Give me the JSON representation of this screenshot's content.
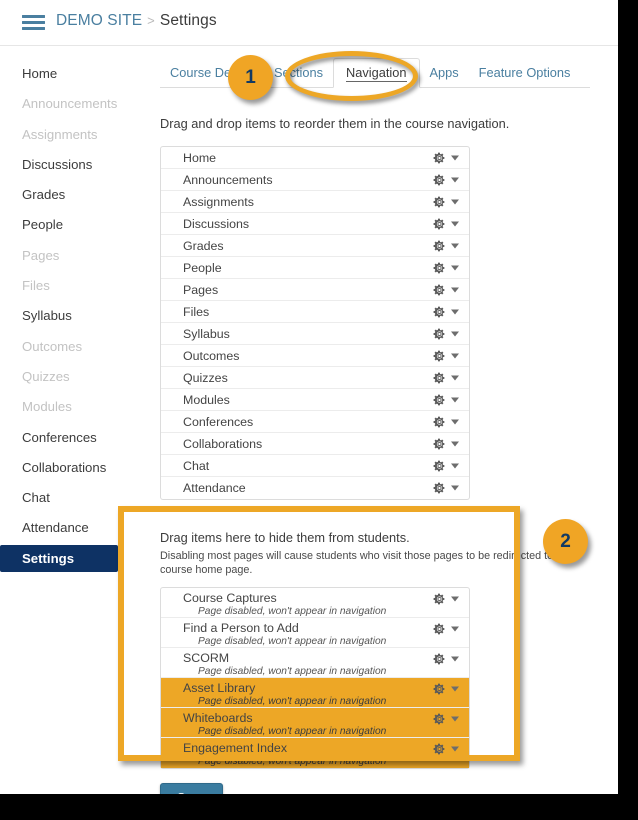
{
  "header": {
    "menu_icon": "hamburger-icon",
    "breadcrumb_root": "DEMO SITE",
    "breadcrumb_separator": ">",
    "breadcrumb_current": "Settings"
  },
  "sidebar": {
    "items": [
      {
        "label": "Home",
        "dim": false,
        "active": false
      },
      {
        "label": "Announcements",
        "dim": true,
        "active": false
      },
      {
        "label": "Assignments",
        "dim": true,
        "active": false
      },
      {
        "label": "Discussions",
        "dim": false,
        "active": false
      },
      {
        "label": "Grades",
        "dim": false,
        "active": false
      },
      {
        "label": "People",
        "dim": false,
        "active": false
      },
      {
        "label": "Pages",
        "dim": true,
        "active": false
      },
      {
        "label": "Files",
        "dim": true,
        "active": false
      },
      {
        "label": "Syllabus",
        "dim": false,
        "active": false
      },
      {
        "label": "Outcomes",
        "dim": true,
        "active": false
      },
      {
        "label": "Quizzes",
        "dim": true,
        "active": false
      },
      {
        "label": "Modules",
        "dim": true,
        "active": false
      },
      {
        "label": "Conferences",
        "dim": false,
        "active": false
      },
      {
        "label": "Collaborations",
        "dim": false,
        "active": false
      },
      {
        "label": "Chat",
        "dim": false,
        "active": false
      },
      {
        "label": "Attendance",
        "dim": false,
        "active": false
      },
      {
        "label": "Settings",
        "dim": false,
        "active": true
      }
    ]
  },
  "tabs": [
    {
      "label": "Course Details",
      "active": false
    },
    {
      "label": "Sections",
      "active": false
    },
    {
      "label": "Navigation",
      "active": true
    },
    {
      "label": "Apps",
      "active": false
    },
    {
      "label": "Feature Options",
      "active": false
    }
  ],
  "main": {
    "reorder_instruction": "Drag and drop items to reorder them in the course navigation.",
    "hidden_heading": "Drag items here to hide them from students.",
    "hidden_subtext": "Disabling most pages will cause students who visit those pages to be redirected to the course home page.",
    "save_label": "Save",
    "disabled_note": "Page disabled, won't appear in navigation",
    "visible_items": [
      {
        "label": "Home"
      },
      {
        "label": "Announcements"
      },
      {
        "label": "Assignments"
      },
      {
        "label": "Discussions"
      },
      {
        "label": "Grades"
      },
      {
        "label": "People"
      },
      {
        "label": "Pages"
      },
      {
        "label": "Files"
      },
      {
        "label": "Syllabus"
      },
      {
        "label": "Outcomes"
      },
      {
        "label": "Quizzes"
      },
      {
        "label": "Modules"
      },
      {
        "label": "Conferences"
      },
      {
        "label": "Collaborations"
      },
      {
        "label": "Chat"
      },
      {
        "label": "Attendance"
      }
    ],
    "hidden_items": [
      {
        "label": "Course Captures",
        "note": "Page disabled, won't appear in navigation",
        "highlighted": false
      },
      {
        "label": "Find a Person to Add",
        "note": "Page disabled, won't appear in navigation",
        "highlighted": false
      },
      {
        "label": "SCORM",
        "note": "Page disabled, won't appear in navigation",
        "highlighted": false
      },
      {
        "label": "Asset Library",
        "note": "Page disabled, won't appear in navigation",
        "highlighted": true
      },
      {
        "label": "Whiteboards",
        "note": "Page disabled, won't appear in navigation",
        "highlighted": true
      },
      {
        "label": "Engagement Index",
        "note": "Page disabled, won't appear in navigation",
        "highlighted": true
      }
    ]
  },
  "annotations": {
    "badge_1": "1",
    "badge_2": "2",
    "highlight_color": "#eda726",
    "badge_color": "#f0a525",
    "badge_text_color": "#123a63"
  },
  "theme": {
    "link_blue": "#4a7fa0",
    "active_navy": "#0e3264",
    "button_blue": "#3a7ca0"
  }
}
